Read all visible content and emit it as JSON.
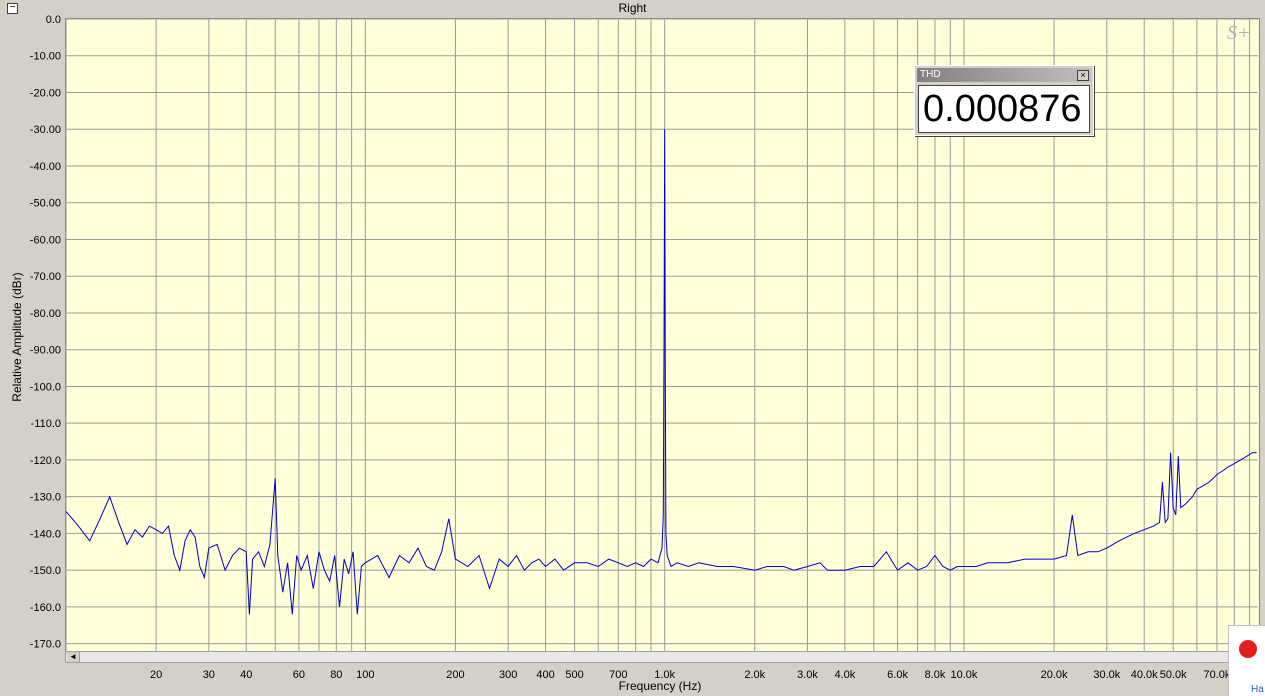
{
  "window": {
    "title": "Right",
    "collapse_glyph": "−"
  },
  "thd_panel": {
    "title": "THD",
    "close_glyph": "×",
    "value": "0.000876"
  },
  "logo_text": "S+",
  "corner": {
    "text": "Ha",
    "icon": "arrow-right-icon"
  },
  "scroll_glyph": "◄",
  "chart_data": {
    "type": "line",
    "title": "Right",
    "xlabel": "Frequency (Hz)",
    "ylabel": "Relative Amplitude (dBr)",
    "x_scale": "log",
    "xlim": [
      10,
      96000
    ],
    "ylim": [
      -172,
      0
    ],
    "grid": true,
    "line_color": "#0000c8",
    "background_color": "#ffffd8",
    "y_ticks": [
      {
        "v": 0,
        "label": "0.0"
      },
      {
        "v": -10,
        "label": "-10.00"
      },
      {
        "v": -20,
        "label": "-20.00"
      },
      {
        "v": -30,
        "label": "-30.00"
      },
      {
        "v": -40,
        "label": "-40.00"
      },
      {
        "v": -50,
        "label": "-50.00"
      },
      {
        "v": -60,
        "label": "-60.00"
      },
      {
        "v": -70,
        "label": "-70.00"
      },
      {
        "v": -80,
        "label": "-80.00"
      },
      {
        "v": -90,
        "label": "-90.00"
      },
      {
        "v": -100,
        "label": "-100.0"
      },
      {
        "v": -110,
        "label": "-110.0"
      },
      {
        "v": -120,
        "label": "-120.0"
      },
      {
        "v": -130,
        "label": "-130.0"
      },
      {
        "v": -140,
        "label": "-140.0"
      },
      {
        "v": -150,
        "label": "-150.0"
      },
      {
        "v": -160,
        "label": "-160.0"
      },
      {
        "v": -170,
        "label": "-170.0"
      }
    ],
    "x_ticks": [
      {
        "v": 20,
        "label": "20"
      },
      {
        "v": 30,
        "label": "30"
      },
      {
        "v": 40,
        "label": "40"
      },
      {
        "v": 60,
        "label": "60"
      },
      {
        "v": 80,
        "label": "80"
      },
      {
        "v": 100,
        "label": "100"
      },
      {
        "v": 200,
        "label": "200"
      },
      {
        "v": 300,
        "label": "300"
      },
      {
        "v": 400,
        "label": "400"
      },
      {
        "v": 500,
        "label": "500"
      },
      {
        "v": 700,
        "label": "700"
      },
      {
        "v": 1000,
        "label": "1.0k"
      },
      {
        "v": 2000,
        "label": "2.0k"
      },
      {
        "v": 3000,
        "label": "3.0k"
      },
      {
        "v": 4000,
        "label": "4.0k"
      },
      {
        "v": 6000,
        "label": "6.0k"
      },
      {
        "v": 8000,
        "label": "8.0k"
      },
      {
        "v": 10000,
        "label": "10.0k"
      },
      {
        "v": 20000,
        "label": "20.0k"
      },
      {
        "v": 30000,
        "label": "30.0k"
      },
      {
        "v": 40000,
        "label": "40.0k"
      },
      {
        "v": 50000,
        "label": "50.0k"
      },
      {
        "v": 70000,
        "label": "70.0k"
      }
    ],
    "x_gridlines": [
      10,
      20,
      30,
      40,
      50,
      60,
      70,
      80,
      90,
      100,
      200,
      300,
      400,
      500,
      600,
      700,
      800,
      900,
      1000,
      2000,
      3000,
      4000,
      5000,
      6000,
      7000,
      8000,
      9000,
      10000,
      20000,
      30000,
      40000,
      50000,
      60000,
      70000,
      80000,
      90000
    ],
    "series": [
      {
        "points": [
          [
            10,
            -134
          ],
          [
            11,
            -138
          ],
          [
            12,
            -142
          ],
          [
            13,
            -136
          ],
          [
            14,
            -130
          ],
          [
            15,
            -137
          ],
          [
            16,
            -143
          ],
          [
            17,
            -139
          ],
          [
            18,
            -141
          ],
          [
            19,
            -138
          ],
          [
            20,
            -139
          ],
          [
            21,
            -140
          ],
          [
            22,
            -138
          ],
          [
            23,
            -146
          ],
          [
            24,
            -150
          ],
          [
            25,
            -142
          ],
          [
            26,
            -139
          ],
          [
            27,
            -141
          ],
          [
            28,
            -149
          ],
          [
            29,
            -152
          ],
          [
            30,
            -144
          ],
          [
            32,
            -143
          ],
          [
            34,
            -150
          ],
          [
            36,
            -146
          ],
          [
            38,
            -144
          ],
          [
            40,
            -145
          ],
          [
            41,
            -162
          ],
          [
            42,
            -147
          ],
          [
            44,
            -145
          ],
          [
            46,
            -149
          ],
          [
            48,
            -143
          ],
          [
            50,
            -125
          ],
          [
            51,
            -146
          ],
          [
            53,
            -156
          ],
          [
            55,
            -148
          ],
          [
            57,
            -162
          ],
          [
            59,
            -146
          ],
          [
            61,
            -150
          ],
          [
            64,
            -146
          ],
          [
            67,
            -155
          ],
          [
            70,
            -145
          ],
          [
            73,
            -150
          ],
          [
            76,
            -153
          ],
          [
            79,
            -146
          ],
          [
            82,
            -160
          ],
          [
            85,
            -147
          ],
          [
            88,
            -151
          ],
          [
            91,
            -145
          ],
          [
            94,
            -162
          ],
          [
            97,
            -149
          ],
          [
            100,
            -148
          ],
          [
            110,
            -146
          ],
          [
            120,
            -152
          ],
          [
            130,
            -146
          ],
          [
            140,
            -148
          ],
          [
            150,
            -144
          ],
          [
            160,
            -149
          ],
          [
            170,
            -150
          ],
          [
            180,
            -145
          ],
          [
            190,
            -136
          ],
          [
            200,
            -147
          ],
          [
            220,
            -149
          ],
          [
            240,
            -146
          ],
          [
            260,
            -155
          ],
          [
            280,
            -147
          ],
          [
            300,
            -149
          ],
          [
            320,
            -146
          ],
          [
            340,
            -150
          ],
          [
            360,
            -148
          ],
          [
            380,
            -147
          ],
          [
            400,
            -149
          ],
          [
            430,
            -147
          ],
          [
            460,
            -150
          ],
          [
            500,
            -148
          ],
          [
            550,
            -148
          ],
          [
            600,
            -149
          ],
          [
            650,
            -147
          ],
          [
            700,
            -148
          ],
          [
            750,
            -149
          ],
          [
            800,
            -148
          ],
          [
            850,
            -149
          ],
          [
            900,
            -147
          ],
          [
            950,
            -148
          ],
          [
            980,
            -144
          ],
          [
            990,
            -135
          ],
          [
            995,
            -90
          ],
          [
            1000,
            -30
          ],
          [
            1005,
            -95
          ],
          [
            1010,
            -140
          ],
          [
            1020,
            -146
          ],
          [
            1050,
            -149
          ],
          [
            1100,
            -148
          ],
          [
            1200,
            -149
          ],
          [
            1300,
            -148
          ],
          [
            1500,
            -149
          ],
          [
            1700,
            -149
          ],
          [
            2000,
            -150
          ],
          [
            2200,
            -149
          ],
          [
            2500,
            -149
          ],
          [
            2700,
            -150
          ],
          [
            3000,
            -149
          ],
          [
            3300,
            -148
          ],
          [
            3500,
            -150
          ],
          [
            4000,
            -150
          ],
          [
            4500,
            -149
          ],
          [
            5000,
            -149
          ],
          [
            5500,
            -145
          ],
          [
            6000,
            -150
          ],
          [
            6500,
            -148
          ],
          [
            7000,
            -150
          ],
          [
            7500,
            -149
          ],
          [
            8000,
            -146
          ],
          [
            8500,
            -149
          ],
          [
            9000,
            -150
          ],
          [
            9500,
            -149
          ],
          [
            10000,
            -149
          ],
          [
            11000,
            -149
          ],
          [
            12000,
            -148
          ],
          [
            14000,
            -148
          ],
          [
            16000,
            -147
          ],
          [
            18000,
            -147
          ],
          [
            20000,
            -147
          ],
          [
            22000,
            -146
          ],
          [
            23000,
            -135
          ],
          [
            24000,
            -146
          ],
          [
            26000,
            -145
          ],
          [
            28000,
            -145
          ],
          [
            30000,
            -144
          ],
          [
            33000,
            -142
          ],
          [
            35000,
            -141
          ],
          [
            37000,
            -140
          ],
          [
            40000,
            -139
          ],
          [
            43000,
            -138
          ],
          [
            45000,
            -137
          ],
          [
            46000,
            -126
          ],
          [
            47000,
            -137
          ],
          [
            48000,
            -136
          ],
          [
            49000,
            -118
          ],
          [
            50000,
            -133
          ],
          [
            51000,
            -135
          ],
          [
            52000,
            -119
          ],
          [
            53000,
            -133
          ],
          [
            55000,
            -132
          ],
          [
            58000,
            -130
          ],
          [
            60000,
            -128
          ],
          [
            63000,
            -127
          ],
          [
            66000,
            -126
          ],
          [
            70000,
            -124
          ],
          [
            73000,
            -123
          ],
          [
            76000,
            -122
          ],
          [
            80000,
            -121
          ],
          [
            84000,
            -120
          ],
          [
            88000,
            -119
          ],
          [
            92000,
            -118
          ],
          [
            95000,
            -118
          ]
        ]
      }
    ]
  }
}
